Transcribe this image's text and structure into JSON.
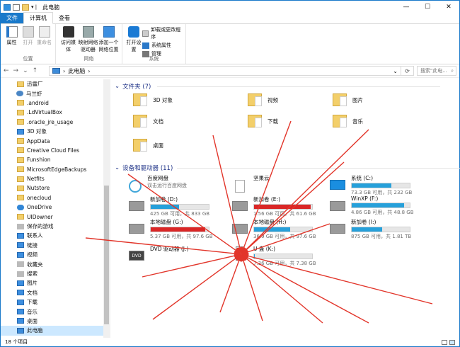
{
  "window": {
    "title": "此电脑",
    "controls": [
      "—",
      "☐",
      "✕"
    ]
  },
  "tabs": [
    "文件",
    "计算机",
    "查看"
  ],
  "ribbon": {
    "groups": [
      {
        "label": "位置",
        "buttons": [
          "属性",
          "打开",
          "重命名"
        ]
      },
      {
        "label": "网络",
        "buttons": [
          "访问媒体",
          "映射网络驱动器",
          "添加一个网络位置"
        ]
      },
      {
        "label": "系统",
        "buttons": [
          "打开设置"
        ],
        "small": [
          "卸载或更改程序",
          "系统属性",
          "管理"
        ]
      }
    ]
  },
  "address": {
    "path": "此电脑",
    "search_placeholder": "搜索\"此电..."
  },
  "sidebar": [
    {
      "label": "迅雷厂",
      "icon": "folder"
    },
    {
      "label": "马兰虾",
      "icon": "user"
    },
    {
      "label": ".android",
      "icon": "folder"
    },
    {
      "label": ".LdVirtualBox",
      "icon": "folder"
    },
    {
      "label": ".oracle_jre_usage",
      "icon": "folder"
    },
    {
      "label": "3D 对象",
      "icon": "blue"
    },
    {
      "label": "AppData",
      "icon": "folder"
    },
    {
      "label": "Creative Cloud Files",
      "icon": "folder"
    },
    {
      "label": "Funshion",
      "icon": "folder"
    },
    {
      "label": "MicrosoftEdgeBackups",
      "icon": "folder"
    },
    {
      "label": "Netfits",
      "icon": "folder"
    },
    {
      "label": "Nutstore",
      "icon": "folder"
    },
    {
      "label": "onecloud",
      "icon": "folder"
    },
    {
      "label": "OneDrive",
      "icon": "cloud"
    },
    {
      "label": "UIDowner",
      "icon": "folder"
    },
    {
      "label": "保存的游戏",
      "icon": "gray"
    },
    {
      "label": "联系人",
      "icon": "blue"
    },
    {
      "label": "链接",
      "icon": "blue"
    },
    {
      "label": "视频",
      "icon": "blue"
    },
    {
      "label": "收藏夹",
      "icon": "gray"
    },
    {
      "label": "搜索",
      "icon": "gray"
    },
    {
      "label": "图片",
      "icon": "blue"
    },
    {
      "label": "文档",
      "icon": "blue"
    },
    {
      "label": "下载",
      "icon": "blue"
    },
    {
      "label": "音乐",
      "icon": "blue"
    },
    {
      "label": "桌面",
      "icon": "blue"
    },
    {
      "label": "此电脑",
      "icon": "pc",
      "selected": true
    }
  ],
  "folders": {
    "header": "文件夹 (7)",
    "items": [
      "3D 对象",
      "视频",
      "图片",
      "文档",
      "下载",
      "音乐",
      "桌面"
    ]
  },
  "drives": {
    "header": "设备和驱动器 (11)",
    "items": [
      {
        "name": "百度网盘",
        "sub": "双击运行百度网盘",
        "icon": "cloud",
        "bar": false
      },
      {
        "name": "坚果云",
        "sub": "",
        "icon": "doc",
        "bar": false
      },
      {
        "name": "系统 (C:)",
        "sub": "73.3 GB 可用，共 232 GB",
        "icon": "win",
        "used": 0.68,
        "red": false
      },
      {
        "name": "新加卷 (D:)",
        "sub": "425 GB 可用，共 833 GB",
        "icon": "hdd",
        "used": 0.49,
        "red": false
      },
      {
        "name": "新加卷 (E:)",
        "sub": "1.56 GB 可用，共 61.6 GB",
        "icon": "hdd",
        "used": 0.97,
        "red": true
      },
      {
        "name": "WinXP (F:)",
        "sub": "4.86 GB 可用，共 48.8 GB",
        "icon": "hdd",
        "used": 0.9,
        "red": false
      },
      {
        "name": "本地磁盘 (G:)",
        "sub": "5.37 GB 可用，共 97.6 GB",
        "icon": "hdd",
        "used": 0.94,
        "red": true
      },
      {
        "name": "本地磁盘 (H:)",
        "sub": "36.9 GB 可用，共 97.6 GB",
        "icon": "hdd",
        "used": 0.62,
        "red": false
      },
      {
        "name": "新加卷 (I:)",
        "sub": "875 GB 可用，共 1.81 TB",
        "icon": "hdd",
        "used": 0.53,
        "red": false
      },
      {
        "name": "DVD 驱动器 (J:)",
        "sub": "",
        "icon": "dvd",
        "bar": false
      },
      {
        "name": "U 盘 (K:)",
        "sub": "7.36 GB 可用，共 7.38 GB",
        "icon": "usb",
        "used": 0.01,
        "red": false
      }
    ]
  },
  "status": {
    "count": "18 个项目"
  }
}
